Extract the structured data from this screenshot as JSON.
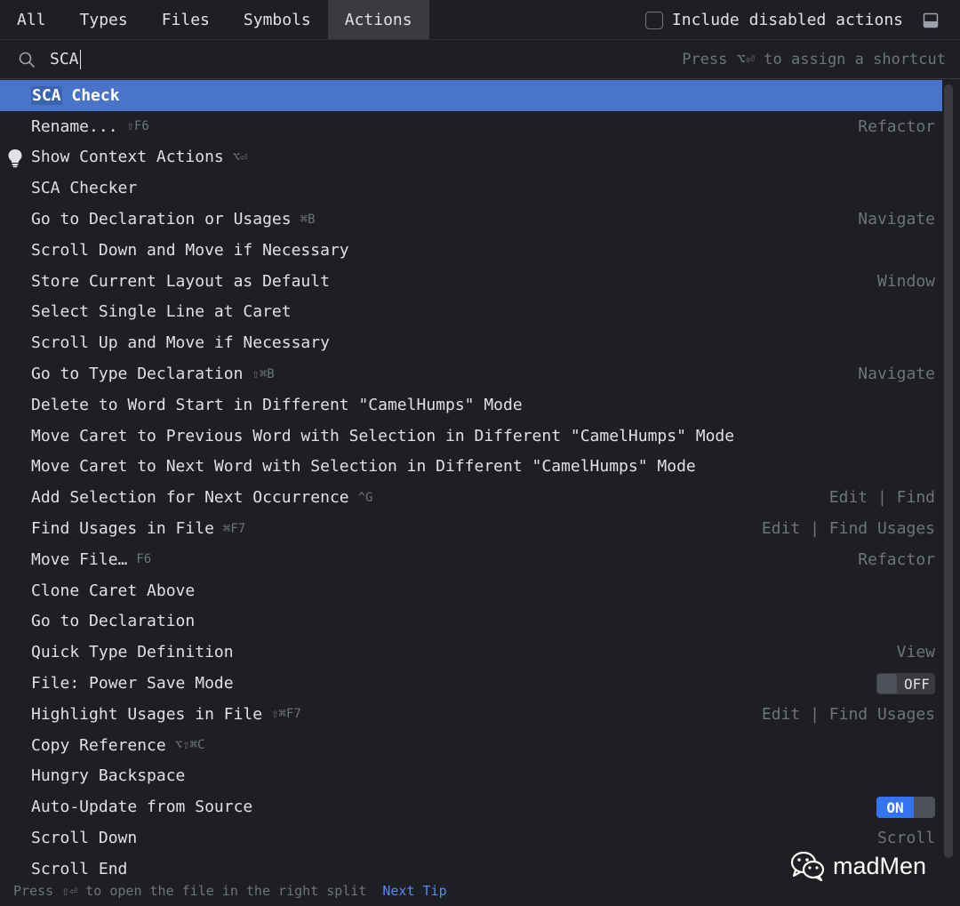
{
  "tabs": [
    {
      "label": "All",
      "active": false
    },
    {
      "label": "Types",
      "active": false
    },
    {
      "label": "Files",
      "active": false
    },
    {
      "label": "Symbols",
      "active": false
    },
    {
      "label": "Actions",
      "active": true
    }
  ],
  "include_disabled_label": "Include disabled actions",
  "search": {
    "value": "SCA",
    "hint": "Press ⌥⏎ to assign a shortcut"
  },
  "rows": [
    {
      "name_hl": "SCA",
      "name_rest": " Check",
      "shortcut": "",
      "group": "",
      "selected": true
    },
    {
      "name": "Rename...",
      "shortcut": "⇧F6",
      "group": "Refactor"
    },
    {
      "name": "Show Context Actions",
      "shortcut": "⌥⏎",
      "group": "",
      "bulb": true
    },
    {
      "name": "SCA Checker",
      "shortcut": "",
      "group": ""
    },
    {
      "name": "Go to Declaration or Usages",
      "shortcut": "⌘B",
      "group": "Navigate"
    },
    {
      "name": "Scroll Down and Move if Necessary",
      "shortcut": "",
      "group": ""
    },
    {
      "name": "Store Current Layout as Default",
      "shortcut": "",
      "group": "Window"
    },
    {
      "name": "Select Single Line at Caret",
      "shortcut": "",
      "group": ""
    },
    {
      "name": "Scroll Up and Move if Necessary",
      "shortcut": "",
      "group": ""
    },
    {
      "name": "Go to Type Declaration",
      "shortcut": "⇧⌘B",
      "group": "Navigate"
    },
    {
      "name": "Delete to Word Start in Different \"CamelHumps\" Mode",
      "shortcut": "",
      "group": ""
    },
    {
      "name": "Move Caret to Previous Word with Selection in Different \"CamelHumps\" Mode",
      "shortcut": "",
      "group": ""
    },
    {
      "name": "Move Caret to Next Word with Selection in Different \"CamelHumps\" Mode",
      "shortcut": "",
      "group": ""
    },
    {
      "name": "Add Selection for Next Occurrence",
      "shortcut": "^G",
      "group": "Edit | Find"
    },
    {
      "name": "Find Usages in File",
      "shortcut": "⌘F7",
      "group": "Edit | Find Usages"
    },
    {
      "name": "Move File…",
      "shortcut": "F6",
      "group": "Refactor"
    },
    {
      "name": "Clone Caret Above",
      "shortcut": "",
      "group": ""
    },
    {
      "name": "Go to Declaration",
      "shortcut": "",
      "group": ""
    },
    {
      "name": "Quick Type Definition",
      "shortcut": "",
      "group": "View"
    },
    {
      "name": "File: Power Save Mode",
      "shortcut": "",
      "group": "",
      "toggle": "OFF"
    },
    {
      "name": "Highlight Usages in File",
      "shortcut": "⇧⌘F7",
      "group": "Edit | Find Usages"
    },
    {
      "name": "Copy Reference",
      "shortcut": "⌥⇧⌘C",
      "group": ""
    },
    {
      "name": "Hungry Backspace",
      "shortcut": "",
      "group": ""
    },
    {
      "name": "Auto-Update from Source",
      "shortcut": "",
      "group": "",
      "toggle": "ON"
    },
    {
      "name": "Scroll Down",
      "shortcut": "",
      "group": "Scroll"
    },
    {
      "name": "Scroll End",
      "shortcut": "",
      "group": ""
    }
  ],
  "footer": {
    "hint": "Press ⇧⏎ to open the file in the right split",
    "next_tip": "Next Tip"
  },
  "watermark": "madMen",
  "colors": {
    "background": "#1e1f22",
    "selection": "#4a74c9",
    "accent_link": "#548af7",
    "toggle_on": "#3574f0"
  }
}
